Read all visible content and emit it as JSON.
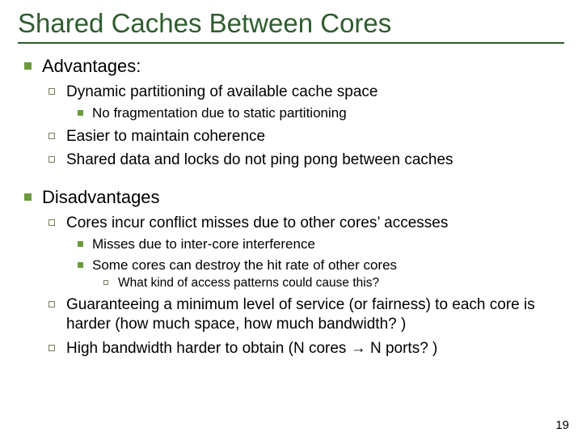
{
  "title": "Shared Caches Between Cores",
  "l1": {
    "adv": "Advantages:",
    "dis": "Disadvantages"
  },
  "adv": {
    "a1": "Dynamic partitioning of available cache space",
    "a1_1": "No fragmentation due to static partitioning",
    "a2": "Easier to maintain coherence",
    "a3": "Shared data and locks do not ping pong between caches"
  },
  "dis": {
    "d1": "Cores incur conflict misses due to other cores’ accesses",
    "d1_1": "Misses due to inter-core interference",
    "d1_2": "Some cores can destroy the hit rate of other cores",
    "d1_2_1": "What kind of access patterns could cause this?",
    "d2": "Guaranteeing a minimum level of service (or fairness) to each core is harder (how much space, how much bandwidth? )",
    "d3": "High bandwidth harder to obtain (N cores → N ports? )"
  },
  "page": "19"
}
